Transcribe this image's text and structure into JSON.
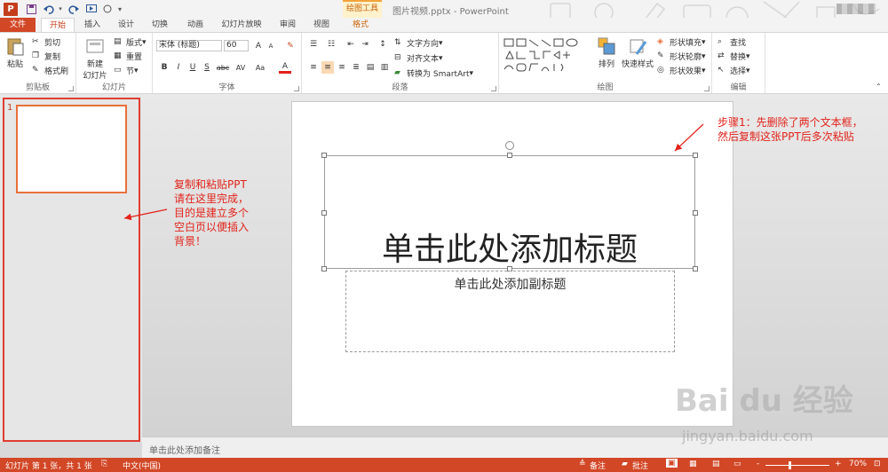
{
  "titlebar": {
    "app_logo": "P",
    "contextual_group": "绘图工具",
    "doc_title": "图片视频.pptx - PowerPoint",
    "quick_access": [
      "save-icon",
      "undo-icon",
      "redo-icon",
      "present-from-start-icon",
      "customize-icon"
    ]
  },
  "tabs": [
    "文件",
    "开始",
    "插入",
    "设计",
    "切换",
    "动画",
    "幻灯片放映",
    "审阅",
    "视图",
    "格式"
  ],
  "ribbon": {
    "clipboard": {
      "paste": "粘贴",
      "cut": "剪切",
      "copy": "复制",
      "format_painter": "格式刷",
      "label": "剪贴板"
    },
    "slides": {
      "new_slide_line1": "新建",
      "new_slide_line2": "幻灯片",
      "layout": "版式",
      "reset": "重置",
      "section": "节",
      "label": "幻灯片"
    },
    "font": {
      "font_name": "宋体 (标题)",
      "font_size": "60",
      "grow": "A",
      "shrink": "A",
      "clear": "✎",
      "bold": "B",
      "italic": "I",
      "underline": "U",
      "shadow": "S",
      "strike": "abc",
      "spacing": "AV",
      "case": "Aa",
      "color": "A",
      "label": "字体"
    },
    "paragraph": {
      "text_direction": "文字方向",
      "align_text": "对齐文本",
      "smartart": "转换为 SmartArt",
      "label": "段落"
    },
    "drawing": {
      "arrange": "排列",
      "quick_styles": "快速样式",
      "shape_fill": "形状填充",
      "shape_outline": "形状轮廓",
      "shape_effects": "形状效果",
      "label": "绘图"
    },
    "editing": {
      "find": "查找",
      "replace": "替换",
      "select": "选择",
      "label": "编辑"
    }
  },
  "thumbnail": {
    "number": "1"
  },
  "slide": {
    "title_placeholder": "单击此处添加标题",
    "subtitle_placeholder": "单击此处添加副标题"
  },
  "notes_placeholder": "单击此处添加备注",
  "statusbar": {
    "slide_info": "幻灯片 第 1 张，共 1 张",
    "language": "中文(中国)",
    "notes": "备注",
    "comments": "批注",
    "zoom_minus": "-",
    "zoom_plus": "+",
    "zoom": "70%"
  },
  "annotations": {
    "left": "复制和粘贴PPT\n请在这里完成，\n目的是建立多个\n空白页以便插入\n背景！",
    "right": "步骤1：先删除了两个文本框，\n然后复制这张PPT后多次粘贴"
  },
  "watermark": {
    "logo": "Bai du 经验",
    "url": "jingyan.baidu.com"
  },
  "colors": {
    "accent": "#d24726",
    "annotation": "#e2231a",
    "contextual": "#f2a33a"
  }
}
